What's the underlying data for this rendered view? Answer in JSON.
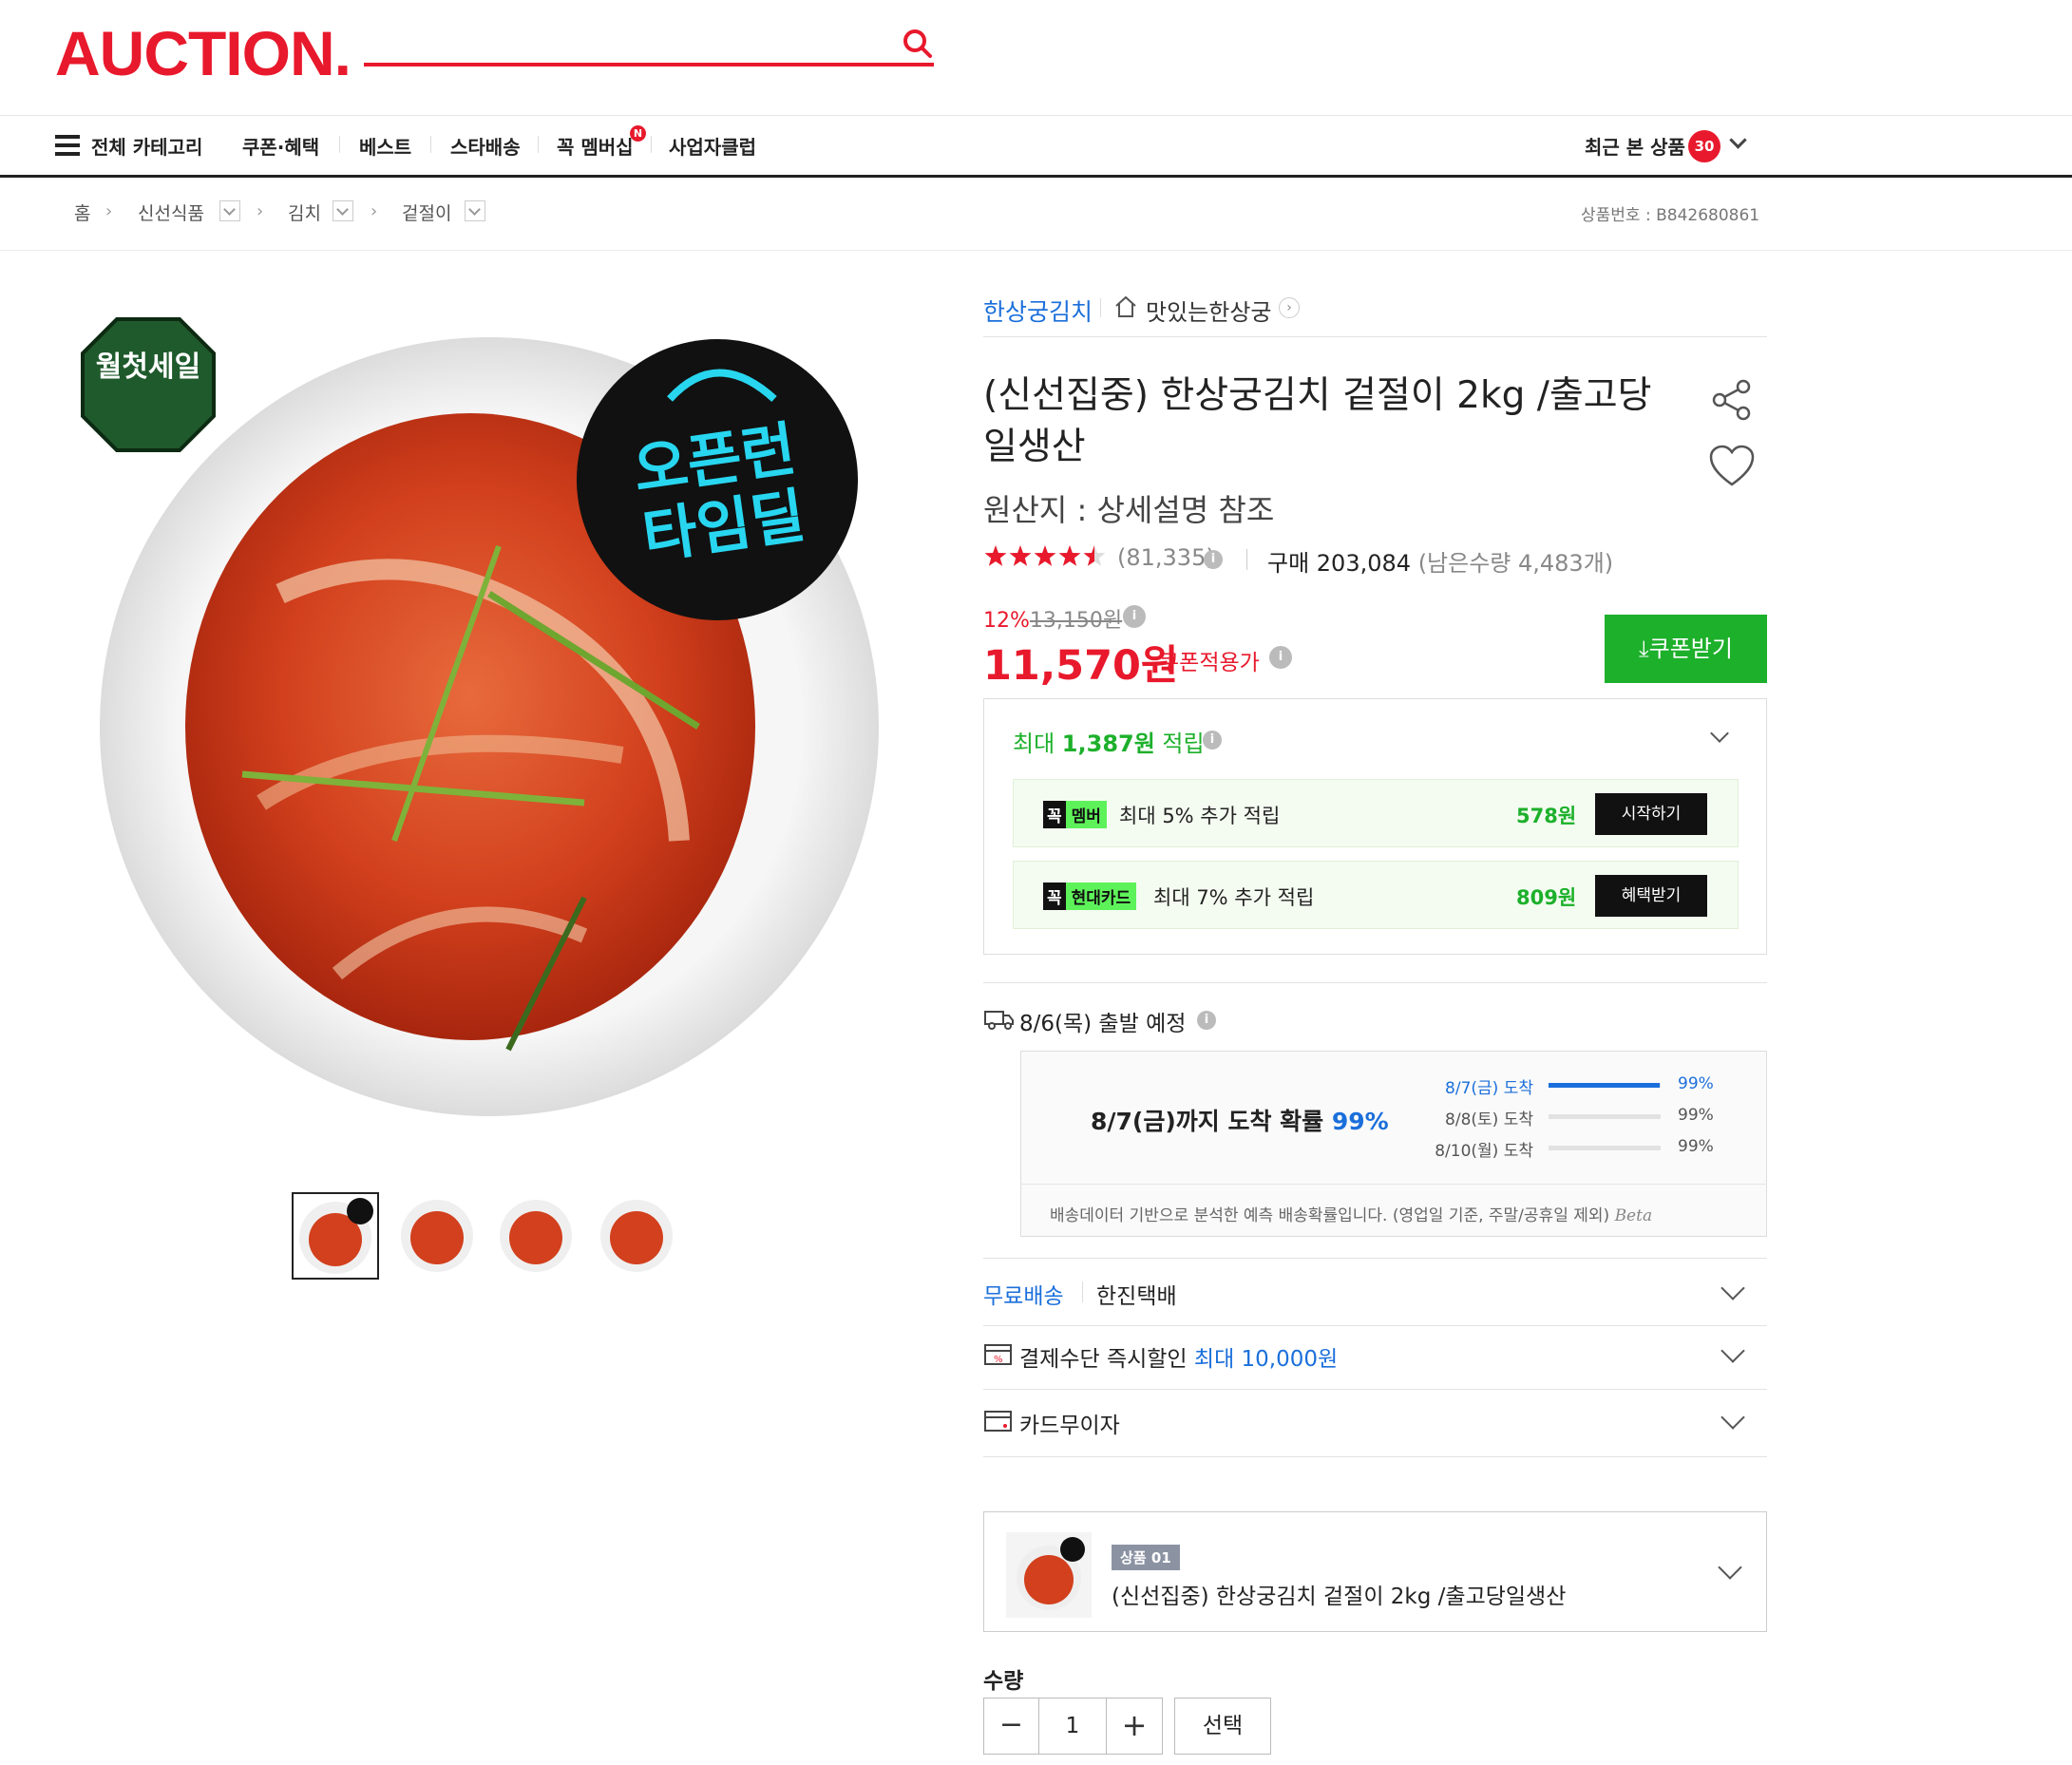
{
  "header": {
    "logo": "AUCTION.",
    "search_icon": "search-icon"
  },
  "nav": {
    "all_categories": "전체 카테고리",
    "items": [
      "쿠폰·혜택",
      "베스트",
      "스타배송",
      "꼭 멤버십",
      "사업자클럽"
    ],
    "membership_badge": "N",
    "recent_label": "최근 본 상품",
    "recent_count": "30"
  },
  "breadcrumb": {
    "home": "홈",
    "level1": "신선식품",
    "level2": "김치",
    "level3": "겉절이",
    "product_no_label": "상품번호 :",
    "product_no": "B842680861"
  },
  "image": {
    "badge_top": "월첫세일",
    "badge_circle_line1": "오픈런",
    "badge_circle_line2": "타임딜"
  },
  "product": {
    "brand": "한상궁김치",
    "store": "맛있는한상궁",
    "title": "(신선집중) 한상궁김치 겉절이 2kg /출고당일생산",
    "origin": "원산지 : 상세설명 참조",
    "rating": 4.5,
    "review_count": "(81,335)",
    "purchase_label": "구매 203,084",
    "remaining": "(남은수량 4,483개)",
    "discount_rate": "12%",
    "original_price": "13,150원",
    "price": "11,570원",
    "coupon_price_label": "쿠폰적용가",
    "coupon_button": "쿠폰받기"
  },
  "rewards": {
    "header_prefix": "최대 ",
    "header_amount": "1,387원",
    "header_suffix": " 적립",
    "rows": [
      {
        "badge_k": "꼭",
        "badge_text": "멤버",
        "desc": "최대 5% 추가 적립",
        "amount": "578원",
        "button": "시작하기"
      },
      {
        "badge_k": "꼭",
        "badge_text": "현대카드",
        "desc": "최대 7% 추가 적립",
        "amount": "809원",
        "button": "혜택받기"
      }
    ]
  },
  "shipping": {
    "depart": "8/6(목) 출발 예정",
    "estimate_main": "8/7(금)까지 도착 확률 ",
    "estimate_pct": "99%",
    "rows": [
      {
        "label": "8/7(금) 도착",
        "pct": "99%",
        "value": 0.99
      },
      {
        "label": "8/8(토) 도착",
        "pct": "99%",
        "value": 0.0
      },
      {
        "label": "8/10(월) 도착",
        "pct": "99%",
        "value": 0.0
      }
    ],
    "note": "배송데이터 기반으로 분석한 예측 배송확률입니다. (영업일 기준, 주말/공휴일 제외)",
    "beta": "Beta",
    "free_shipping": "무료배송",
    "courier": "한진택배",
    "payment_label": "결제수단 즉시할인 ",
    "payment_highlight": "최대 10,000원",
    "installment": "카드무이자"
  },
  "option": {
    "tag": "상품 01",
    "name": "(신선집중) 한상궁김치 겉절이 2kg /출고당일생산"
  },
  "quantity": {
    "label": "수량",
    "value": "1",
    "minus": "−",
    "plus": "+",
    "select": "선택"
  },
  "colors": {
    "brand_red": "#e8192c",
    "green": "#1db02b",
    "blue": "#1b6fdb"
  }
}
